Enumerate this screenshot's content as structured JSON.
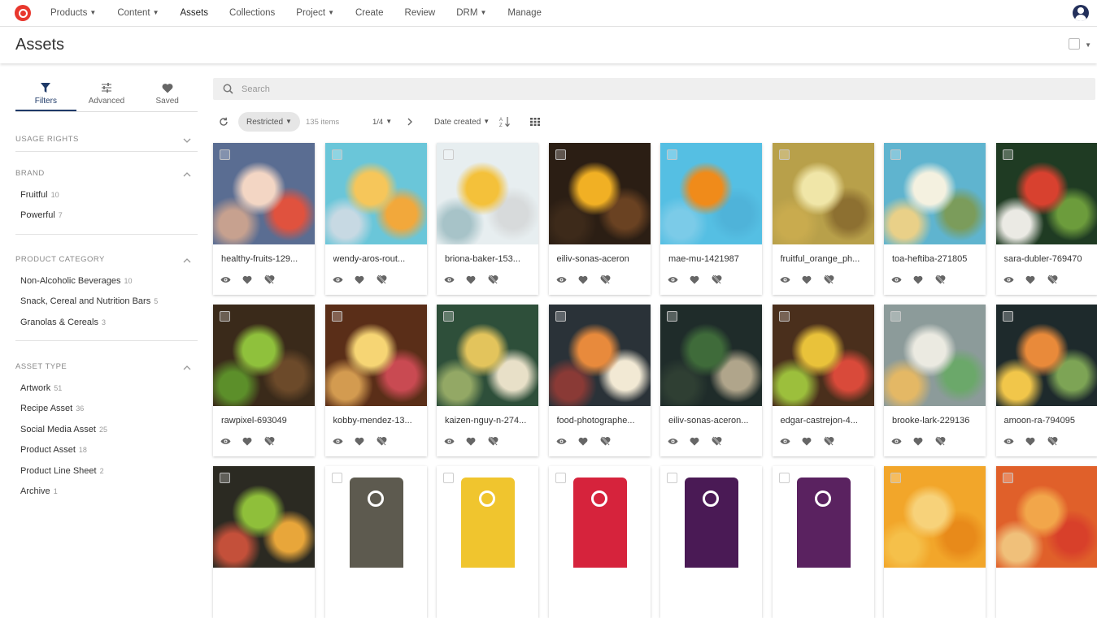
{
  "nav": {
    "items": [
      {
        "label": "Products",
        "caret": true
      },
      {
        "label": "Content",
        "caret": true
      },
      {
        "label": "Assets",
        "caret": false,
        "active": true
      },
      {
        "label": "Collections",
        "caret": false
      },
      {
        "label": "Project",
        "caret": true
      },
      {
        "label": "Create",
        "caret": false
      },
      {
        "label": "Review",
        "caret": false
      },
      {
        "label": "DRM",
        "caret": true
      },
      {
        "label": "Manage",
        "caret": false
      }
    ]
  },
  "page": {
    "title": "Assets"
  },
  "sidebar": {
    "tabs": [
      {
        "label": "Filters",
        "icon": "funnel-icon",
        "active": true
      },
      {
        "label": "Advanced",
        "icon": "sliders-icon",
        "active": false
      },
      {
        "label": "Saved",
        "icon": "heart-icon",
        "active": false
      }
    ],
    "sections": [
      {
        "title": "Usage Rights",
        "expanded": false,
        "items": []
      },
      {
        "title": "Brand",
        "expanded": true,
        "items": [
          {
            "label": "Fruitful",
            "count": "10"
          },
          {
            "label": "Powerful",
            "count": "7"
          }
        ]
      },
      {
        "title": "Product Category",
        "expanded": true,
        "items": [
          {
            "label": "Non-Alcoholic Beverages",
            "count": "10"
          },
          {
            "label": "Snack, Cereal and Nutrition Bars",
            "count": "5"
          },
          {
            "label": "Granolas & Cereals",
            "count": "3"
          }
        ]
      },
      {
        "title": "Asset Type",
        "expanded": true,
        "items": [
          {
            "label": "Artwork",
            "count": "51"
          },
          {
            "label": "Recipe Asset",
            "count": "36"
          },
          {
            "label": "Social Media Asset",
            "count": "25"
          },
          {
            "label": "Product Asset",
            "count": "18"
          },
          {
            "label": "Product Line Sheet",
            "count": "2"
          },
          {
            "label": "Archive",
            "count": "1"
          }
        ]
      }
    ]
  },
  "search": {
    "placeholder": "Search"
  },
  "toolbar": {
    "filter_label": "Restricted",
    "count": "135 items",
    "page": "1/4",
    "sort": "Date created"
  },
  "assets": [
    {
      "name": "healthy-fruits-129...",
      "colors": [
        "#5a6d92",
        "#f3d6c4",
        "#e0523e",
        "#c7a18f"
      ]
    },
    {
      "name": "wendy-aros-rout...",
      "colors": [
        "#6ac6d9",
        "#f6c65a",
        "#f2a83b",
        "#c7d9e3"
      ]
    },
    {
      "name": "briona-baker-153...",
      "colors": [
        "#e7eef0",
        "#f4c13a",
        "#d7dadb",
        "#a7c3c8"
      ]
    },
    {
      "name": "eiliv-sonas-aceron",
      "colors": [
        "#2b1e14",
        "#f1b024",
        "#6a4222",
        "#3d2a1a"
      ]
    },
    {
      "name": "mae-mu-1421987",
      "colors": [
        "#55bfe3",
        "#f08b1a",
        "#4fb3d9",
        "#7bcbe8"
      ]
    },
    {
      "name": "fruitful_orange_ph...",
      "colors": [
        "#b8a04a",
        "#f0e6a8",
        "#8d7031",
        "#c9ab4e"
      ]
    },
    {
      "name": "toa-heftiba-271805",
      "colors": [
        "#5fb4cf",
        "#f4f1e0",
        "#7b9c5b",
        "#e9d088"
      ]
    },
    {
      "name": "sara-dubler-769470",
      "colors": [
        "#1f3b23",
        "#d8412f",
        "#6c9c3c",
        "#ebeae4"
      ]
    },
    {
      "name": "rawpixel-693049",
      "colors": [
        "#3a2a1a",
        "#8fc13c",
        "#6c4a2a",
        "#5c8f2a"
      ]
    },
    {
      "name": "kobby-mendez-13...",
      "colors": [
        "#5a2e18",
        "#f6d574",
        "#c94a52",
        "#d39b50"
      ]
    },
    {
      "name": "kaizen-nguy-n-274...",
      "colors": [
        "#2e4f3a",
        "#e3c45c",
        "#e8e0c8",
        "#93a865"
      ]
    },
    {
      "name": "food-photographe...",
      "colors": [
        "#2a3238",
        "#e88a3c",
        "#f2e9d4",
        "#8a3a36"
      ]
    },
    {
      "name": "eiliv-sonas-aceron...",
      "colors": [
        "#1f2c2a",
        "#3f6b3a",
        "#b0a58b",
        "#2f3f33"
      ]
    },
    {
      "name": "edgar-castrejon-4...",
      "colors": [
        "#4a2f1c",
        "#e9c23a",
        "#d94a3a",
        "#9cbf3c"
      ]
    },
    {
      "name": "brooke-lark-229136",
      "colors": [
        "#8c9b9a",
        "#ebeae1",
        "#6ba86a",
        "#e4b865"
      ]
    },
    {
      "name": "amoon-ra-794095",
      "colors": [
        "#1e2a2c",
        "#e98a3a",
        "#7da455",
        "#f1c64a"
      ]
    },
    {
      "name": "",
      "colors": [
        "#2b2a22",
        "#8fbf3a",
        "#e8a63a",
        "#c4503a"
      ]
    },
    {
      "name": "",
      "colors": [
        "#ffffff",
        "#5d5a4f",
        "#ffffff",
        "#ffffff"
      ]
    },
    {
      "name": "",
      "colors": [
        "#ffffff",
        "#f0c52e",
        "#ffffff",
        "#ffffff"
      ]
    },
    {
      "name": "",
      "colors": [
        "#ffffff",
        "#d6233c",
        "#ffffff",
        "#ffffff"
      ]
    },
    {
      "name": "",
      "colors": [
        "#ffffff",
        "#4a1a55",
        "#ffffff",
        "#ffffff"
      ]
    },
    {
      "name": "",
      "colors": [
        "#ffffff",
        "#5a2260",
        "#ffffff",
        "#ffffff"
      ]
    },
    {
      "name": "",
      "colors": [
        "#f2a62a",
        "#f7d27a",
        "#e88a1a",
        "#f5c04a"
      ]
    },
    {
      "name": "",
      "colors": [
        "#e0602a",
        "#f2a64a",
        "#d8402a",
        "#f0c07a"
      ]
    }
  ]
}
